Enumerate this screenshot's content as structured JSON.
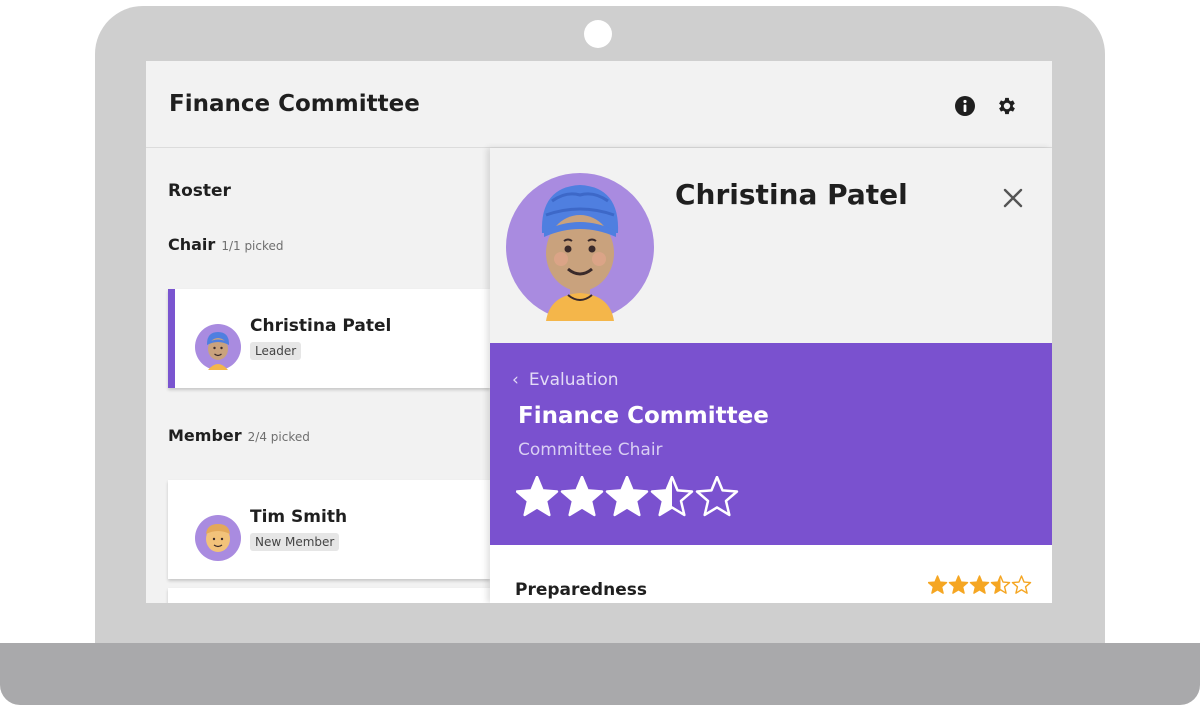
{
  "header": {
    "title": "Finance Committee",
    "icons": [
      "info-icon",
      "gear-icon"
    ]
  },
  "roster": {
    "heading": "Roster",
    "groups": [
      {
        "label": "Chair",
        "count": "1/1 picked",
        "members": [
          {
            "name": "Christina Patel",
            "tag": "Leader",
            "selected": true
          }
        ]
      },
      {
        "label": "Member",
        "count": "2/4 picked",
        "members": [
          {
            "name": "Tim Smith",
            "tag": "New Member",
            "selected": false
          }
        ]
      }
    ]
  },
  "detail": {
    "name": "Christina Patel",
    "evaluation": {
      "back_label": "Evaluation",
      "committee": "Finance Committee",
      "role": "Committee Chair",
      "rating": 3.5,
      "rating_max": 5
    },
    "criteria": [
      {
        "label": "Preparedness",
        "rating": 3.5,
        "rating_max": 5
      }
    ]
  },
  "colors": {
    "accent": "#7a51cf",
    "star_gold": "#f5a623",
    "screen_bg": "#f2f2f2",
    "laptop_frame": "#cfcfcf"
  }
}
